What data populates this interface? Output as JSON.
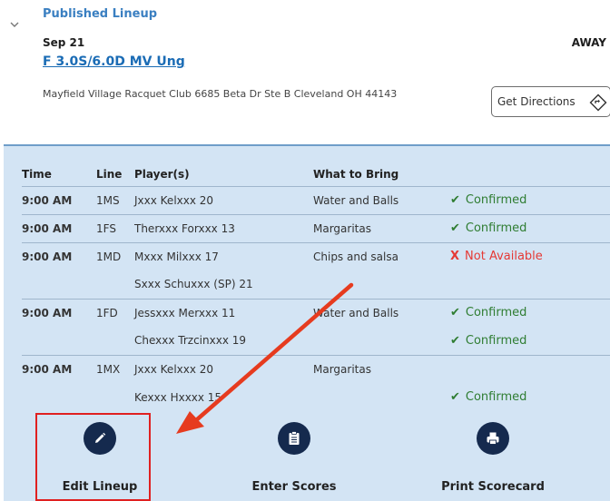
{
  "section": {
    "title": "Published Lineup",
    "date": "Sep 21",
    "home_away": "AWAY",
    "match_name": "F 3.0S/6.0D MV Ung",
    "address": "Mayfield Village Racquet Club 6685 Beta Dr Ste B Cleveland OH 44143",
    "directions_label": "Get Directions"
  },
  "table": {
    "headers": {
      "time": "Time",
      "line": "Line",
      "players": "Player(s)",
      "bring": "What to Bring"
    },
    "rows": [
      {
        "time": "9:00 AM",
        "line": "1MS",
        "player": "Jxxx Kelxxx  20",
        "bring": "Water and Balls",
        "status": "Confirmed",
        "status_mark": "✔"
      },
      {
        "time": "9:00 AM",
        "line": "1FS",
        "player": "Therxxx Forxxx  13",
        "bring": "Margaritas",
        "status": "Confirmed",
        "status_mark": "✔"
      },
      {
        "time": "9:00 AM",
        "line": "1MD",
        "player": "Mxxx Milxxx  17",
        "bring": "Chips and salsa",
        "status": "Not Available",
        "status_mark": "X"
      },
      {
        "time": "",
        "line": "",
        "player": "Sxxx Schuxxx (SP) 21",
        "bring": "",
        "status": "",
        "status_mark": ""
      },
      {
        "time": "9:00 AM",
        "line": "1FD",
        "player": "Jessxxx Merxxx  11",
        "bring": "Water and Balls",
        "status": "Confirmed",
        "status_mark": "✔"
      },
      {
        "time": "",
        "line": "",
        "player": "Chexxx Trzcinxxx  19",
        "bring": "",
        "status": "Confirmed",
        "status_mark": "✔"
      },
      {
        "time": "9:00 AM",
        "line": "1MX",
        "player": "Jxxx Kelxxx  20",
        "bring": "Margaritas",
        "status": "",
        "status_mark": ""
      },
      {
        "time": "",
        "line": "",
        "player": "Kexxx Hxxxx  15",
        "bring": "",
        "status": "Confirmed",
        "status_mark": "✔"
      }
    ]
  },
  "actions": {
    "edit_label": "Edit Lineup",
    "scores_label": "Enter Scores",
    "print_label": "Print Scorecard"
  },
  "colors": {
    "link": "#1b6cb5",
    "confirmed": "#2f7d32",
    "not_available": "#e53935",
    "panel_bg": "#d3e4f4",
    "icon_circle": "#152a4e",
    "annotation": "#e02020"
  },
  "icons": {
    "chevron": "chevron-down-icon",
    "directions": "directions-icon",
    "edit": "pencil-icon",
    "scores": "clipboard-icon",
    "print": "printer-icon"
  }
}
